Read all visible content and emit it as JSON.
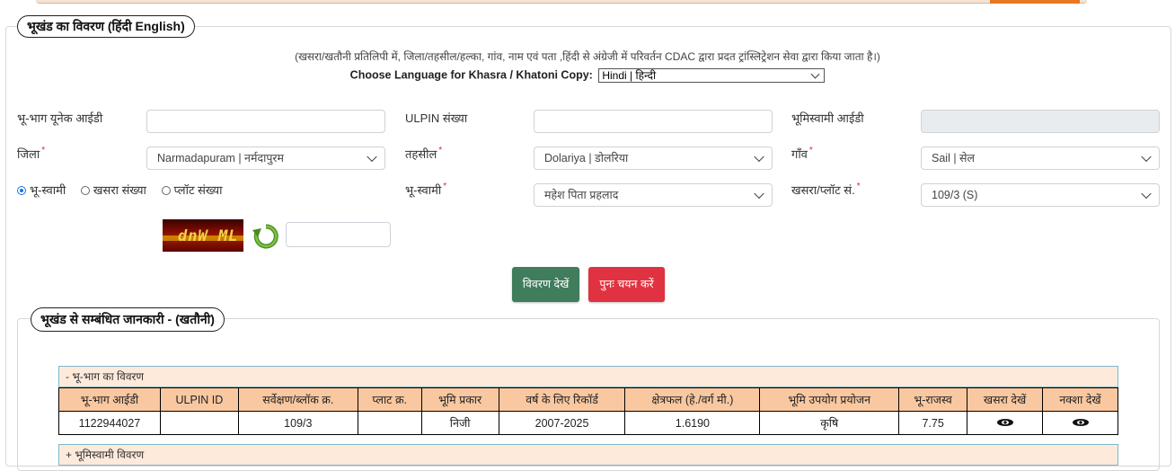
{
  "header": {
    "legend_title": "भूखंड का विवरण  (हिंदी  English)"
  },
  "notice": "(खसरा/खतौनी प्रतिलिपी में, जिला/तहसील/हल्का, गांव, नाम एवं पता ,हिंदी से अंग्रेजी में परिवर्तन CDAC द्वारा प्रदत ट्रांस्लिट्रेशन सेवा द्वारा किया जाता है।)",
  "language": {
    "label": "Choose Language for Khasra / Khatoni Copy:",
    "selected": "Hindi | हिन्दी"
  },
  "form": {
    "unique_id_label": "भू-भाग यूनेक आईडी",
    "unique_id_value": "",
    "ulpin_label": "ULPIN संख्या",
    "ulpin_value": "",
    "owner_id_label": "भूमिस्वामी आईडी",
    "owner_id_value": "",
    "district_label": "जिला",
    "district_value": "Narmadapuram | नर्मदापुरम",
    "tehsil_label": "तहसील",
    "tehsil_value": "Dolariya | डोलरिया",
    "village_label": "गाँव",
    "village_value": "Sail | सेल",
    "owner_label": "भू-स्वामी",
    "owner_value": "महेश पिता प्रहलाद",
    "khasra_label": "खसरा/प्लॉट सं.",
    "khasra_value": "109/3 (S)",
    "required_mark": "*",
    "search_by": [
      {
        "label": "भू-स्वामी",
        "checked": true
      },
      {
        "label": "खसरा संख्या",
        "checked": false
      },
      {
        "label": "प्लॉट संख्या",
        "checked": false
      }
    ],
    "captcha_text": "dnW ML",
    "captcha_input": ""
  },
  "buttons": {
    "view": "विवरण देखें",
    "reset": "पुनः चयन करें"
  },
  "results": {
    "legend_title": "भूखंड से सम्बंधित जानकारी -   (खतौनी)",
    "section_title": "- भू-भाग का विवरण",
    "section2_title": "+ भूमिस्वामी विवरण",
    "columns": [
      "भू-भाग आईडी",
      "ULPIN ID",
      "सर्वेक्षण/ब्लॉक क्र.",
      "प्लाट क्र.",
      "भूमि प्रकार",
      "वर्ष के लिए रिकॉर्ड",
      "क्षेत्रफल (हे./वर्ग मी.)",
      "भूमि उपयोग प्रयोजन",
      "भू-राजस्व",
      "खसरा देखें",
      "नक्शा देखें"
    ],
    "row": {
      "id": "1122944027",
      "ulpin": "",
      "survey": "109/3",
      "plot": "",
      "land_type": "निजी",
      "year": "2007-2025",
      "area": "1.6190",
      "use": "कृषि",
      "revenue": "7.75"
    }
  },
  "colors": {
    "view_button": "#3f7d5c",
    "reset_button": "#e03240",
    "table_header": "#f9c8a1",
    "section_header": "#fdeadb",
    "required": "#e0262f"
  }
}
